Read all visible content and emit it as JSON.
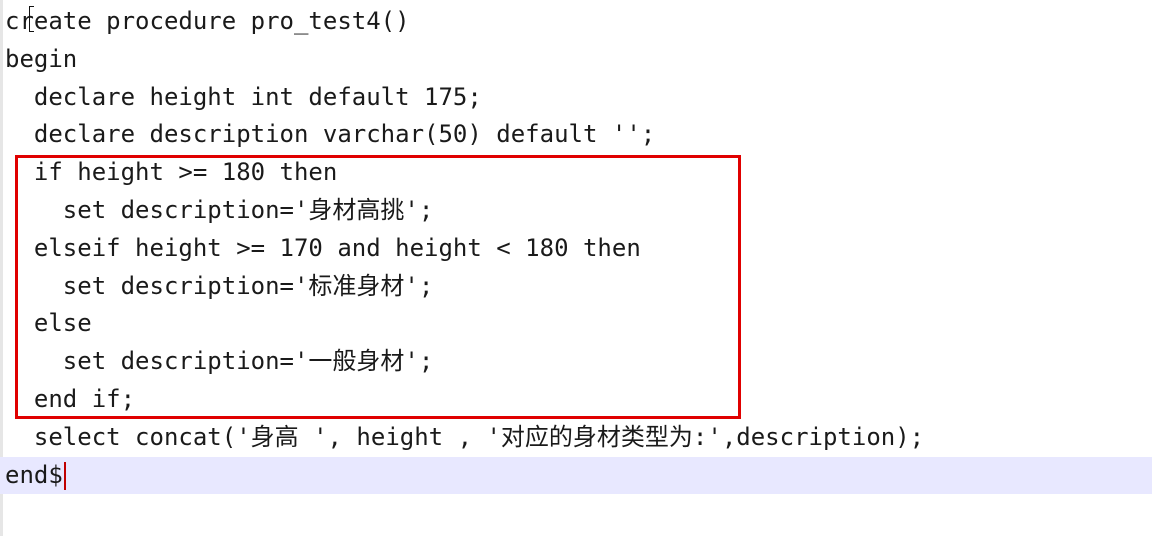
{
  "editor": {
    "lines": [
      "create procedure pro_test4()",
      "begin",
      "  declare height int default 175;",
      "  declare description varchar(50) default '';",
      "  if height >= 180 then",
      "    set description='身材高挑';",
      "  elseif height >= 170 and height < 180 then",
      "    set description='标准身材';",
      "  else",
      "    set description='一般身材';",
      "  end if;",
      "  select concat('身高 ', height , '对应的身材类型为:',description);",
      "end$"
    ],
    "current_line_index": 12
  },
  "colors": {
    "highlight_border": "#e00000",
    "current_line_bg": "#e8e8ff",
    "caret": "#c00000",
    "text": "#1a1a1a"
  }
}
